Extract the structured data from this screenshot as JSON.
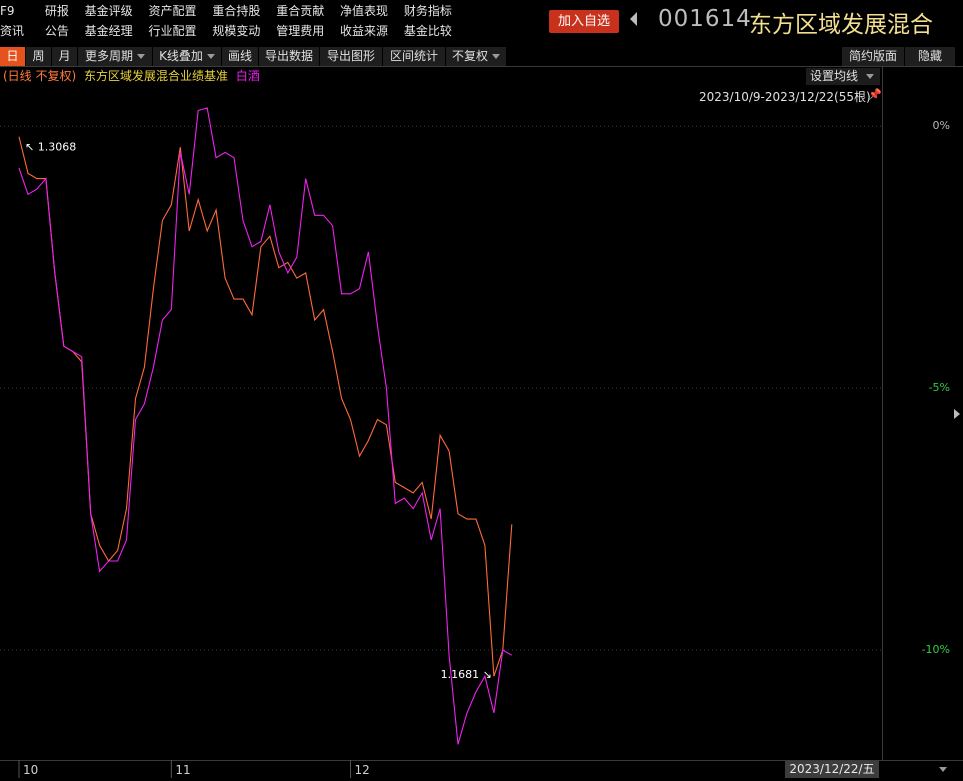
{
  "nav": {
    "row1": [
      "F9",
      "研报",
      "基金评级",
      "资产配置",
      "重合持股",
      "重合贡献",
      "净值表现",
      "财务指标"
    ],
    "row2": [
      "资讯",
      "公告",
      "基金经理",
      "行业配置",
      "规模变动",
      "管理费用",
      "收益来源",
      "基金比较"
    ]
  },
  "header": {
    "add_watch_label": "加入自选",
    "fund_code": "001614",
    "fund_name": "东方区域发展混合"
  },
  "toolbar": {
    "items": [
      "日",
      "周",
      "月",
      "更多周期",
      "K线叠加",
      "画线",
      "导出数据",
      "导出图形",
      "区间统计",
      "不复权"
    ],
    "right_items": [
      "简约版面",
      "隐藏"
    ]
  },
  "legend": {
    "period_label": "(日线 不复权)",
    "series1_label": "东方区域发展混合业绩基准",
    "series2_label": "白酒",
    "set_ma_label": "设置均线",
    "date_range": "2023/10/9-2023/12/22(55根)"
  },
  "colors": {
    "accent": "#e5521e",
    "series_orange": "#ff6a3a",
    "series_magenta": "#ee22ee",
    "legend_orange": "#ff7a3a",
    "legend_yellow": "#e8d23a",
    "legend_magenta": "#ee22ee",
    "grid": "#3a3a3a"
  },
  "chart_data": {
    "type": "line",
    "y_axis_labels": [
      "0%",
      "-5%",
      "-10%"
    ],
    "y_values": [
      0,
      -5,
      -10
    ],
    "ylim": [
      -12.1,
      1.15
    ],
    "x_tick_labels": [
      "10",
      "11",
      "12"
    ],
    "x_tick_index": [
      0,
      17,
      37
    ],
    "max_annotation": "1.3068",
    "min_annotation": "1.1681",
    "cursor_date": "2023/12/22/五",
    "series": [
      {
        "name": "东方区域发展混合业绩基准",
        "values": [
          -0.2,
          -0.9,
          -1.0,
          -1.0,
          -2.8,
          -4.2,
          -4.3,
          -4.5,
          -7.4,
          -8.0,
          -8.3,
          -8.1,
          -7.3,
          -5.2,
          -4.6,
          -3.1,
          -1.8,
          -1.5,
          -0.4,
          -2.0,
          -1.4,
          -2.0,
          -1.6,
          -2.9,
          -3.3,
          -3.3,
          -3.6,
          -2.3,
          -2.1,
          -2.7,
          -2.6,
          -2.9,
          -2.8,
          -3.7,
          -3.5,
          -4.3,
          -5.2,
          -5.6,
          -6.3,
          -6.0,
          -5.6,
          -5.7,
          -6.8,
          -6.9,
          -7.0,
          -6.8,
          -7.5,
          -5.9,
          -6.2,
          -7.4,
          -7.5,
          -7.5,
          -8.0,
          -10.5,
          -10.0,
          -7.6
        ]
      },
      {
        "name": "白酒",
        "values": [
          -0.8,
          -1.3,
          -1.2,
          -1.0,
          -2.8,
          -4.2,
          -4.3,
          -4.4,
          -7.4,
          -8.5,
          -8.3,
          -8.3,
          -7.9,
          -5.6,
          -5.3,
          -4.6,
          -3.7,
          -3.5,
          -0.5,
          -1.3,
          0.3,
          0.35,
          -0.6,
          -0.5,
          -0.6,
          -1.8,
          -2.3,
          -2.2,
          -1.5,
          -2.4,
          -2.8,
          -2.5,
          -1.0,
          -1.7,
          -1.7,
          -1.9,
          -3.2,
          -3.2,
          -3.1,
          -2.4,
          -3.8,
          -5.0,
          -7.2,
          -7.1,
          -7.3,
          -7.0,
          -7.9,
          -7.3,
          -10.1,
          -11.8,
          -11.2,
          -10.8,
          -10.5,
          -11.2,
          -10.0,
          -10.1
        ]
      }
    ]
  }
}
